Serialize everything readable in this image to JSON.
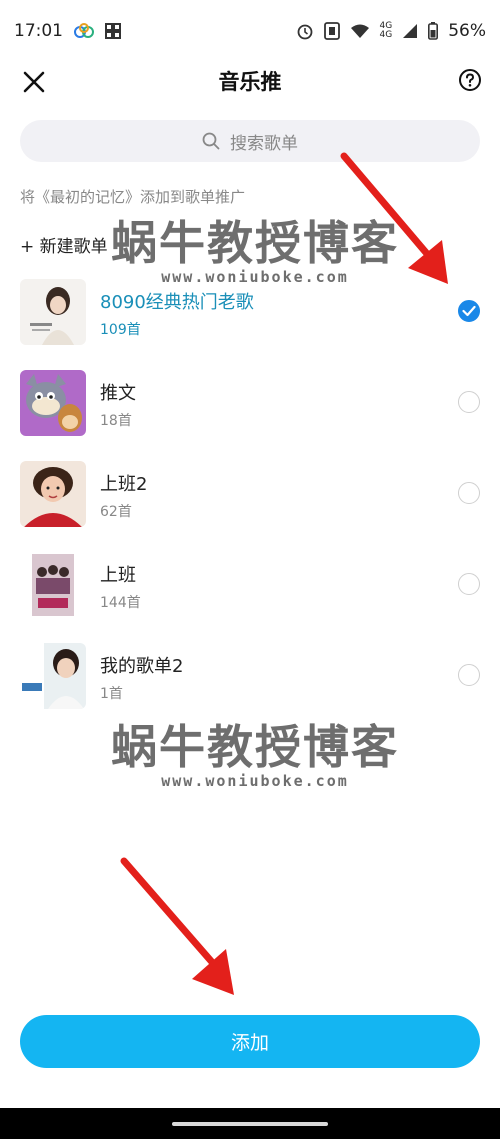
{
  "status_bar": {
    "time": "17:01",
    "battery": "56%",
    "net_top": "4G",
    "net_bottom": "4G"
  },
  "header": {
    "title": "音乐推"
  },
  "search": {
    "placeholder": "搜索歌单"
  },
  "hint": "将《最初的记忆》添加到歌单推广",
  "new_playlist_label": "+ 新建歌单",
  "playlists": [
    {
      "name": "8090经典热门老歌",
      "count": "109首",
      "selected": true
    },
    {
      "name": "推文",
      "count": "18首",
      "selected": false
    },
    {
      "name": "上班2",
      "count": "62首",
      "selected": false
    },
    {
      "name": "上班",
      "count": "144首",
      "selected": false
    },
    {
      "name": "我的歌单2",
      "count": "1首",
      "selected": false
    }
  ],
  "watermark": {
    "text": "蜗牛教授博客",
    "url": "www.woniuboke.com"
  },
  "add_button_label": "添加",
  "colors": {
    "accent": "#14b5f2",
    "selected_text": "#1a8fb8",
    "check": "#1a88e8",
    "arrow": "#e3201b"
  }
}
